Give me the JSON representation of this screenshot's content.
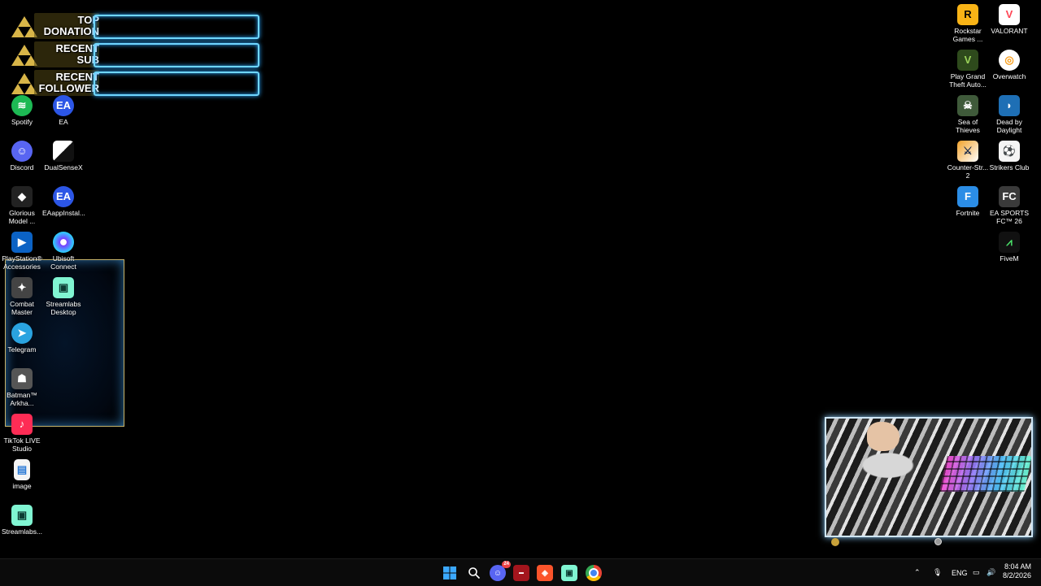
{
  "overlay": {
    "rows": [
      {
        "line1": "TOP",
        "line2": "DONATION"
      },
      {
        "line1": "RECENT",
        "line2": "SUB"
      },
      {
        "line1": "RECENT",
        "line2": "FOLLOWER"
      }
    ]
  },
  "desktop_left": [
    {
      "label": "Spotify",
      "icon": "spotify-icon"
    },
    {
      "label": "EA",
      "icon": "ea-icon"
    },
    {
      "label": "Discord",
      "icon": "discord-icon"
    },
    {
      "label": "DualSenseX",
      "icon": "dualsensex-icon"
    },
    {
      "label": "Glorious Model ...",
      "icon": "glorious-icon"
    },
    {
      "label": "EAappInstal...",
      "icon": "ea-installer-icon"
    },
    {
      "label": "PlayStation® Accessories",
      "icon": "playstation-icon"
    },
    {
      "label": "Ubisoft Connect",
      "icon": "ubisoft-icon"
    },
    {
      "label": "Combat Master",
      "icon": "combat-master-icon"
    },
    {
      "label": "Streamlabs Desktop",
      "icon": "streamlabs-icon"
    },
    {
      "label": "Telegram",
      "icon": "telegram-icon"
    },
    {
      "label": "Batman™ Arkha...",
      "icon": "batman-icon"
    },
    {
      "label": "TikTok LIVE Studio",
      "icon": "tiktok-icon"
    },
    {
      "label": "image",
      "icon": "image-file-icon"
    },
    {
      "label": "Streamlabs...",
      "icon": "streamlabs-icon"
    }
  ],
  "desktop_right": [
    {
      "label": "Rockstar Games ...",
      "icon": "rockstar-icon"
    },
    {
      "label": "VALORANT",
      "icon": "valorant-icon"
    },
    {
      "label": "Play Grand Theft Auto...",
      "icon": "gta-icon"
    },
    {
      "label": "Overwatch",
      "icon": "overwatch-icon"
    },
    {
      "label": "Sea of Thieves",
      "icon": "sea-of-thieves-icon"
    },
    {
      "label": "Dead by Daylight",
      "icon": "dead-by-daylight-icon"
    },
    {
      "label": "Counter-Str... 2",
      "icon": "counter-strike-icon"
    },
    {
      "label": "Strikers Club",
      "icon": "strikers-club-icon"
    },
    {
      "label": "Fortnite",
      "icon": "fortnite-icon"
    },
    {
      "label": "EA SPORTS FC™ 26",
      "icon": "ea-fc-icon"
    },
    {
      "label": "FiveM",
      "icon": "fivem-icon"
    }
  ],
  "taskbar": {
    "language": "ENG",
    "time": "8:04 AM",
    "date": "8/2/2026",
    "discord_badge": "24"
  },
  "colors": {
    "overlay_glow": "#6fd6ff",
    "folder_border": "#c8b46a",
    "taskbar_bg": "#0b0b0b"
  }
}
